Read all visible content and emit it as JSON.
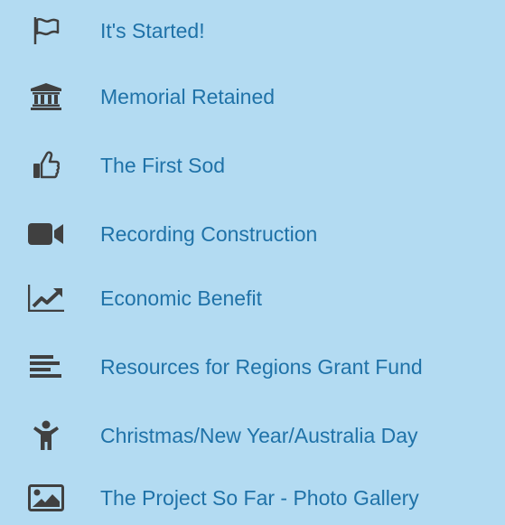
{
  "menu": {
    "items": [
      {
        "label": "It's Started!",
        "icon": "flag-icon"
      },
      {
        "label": "Memorial Retained",
        "icon": "institution-icon"
      },
      {
        "label": "The First Sod",
        "icon": "thumbs-up-icon"
      },
      {
        "label": "Recording Construction",
        "icon": "video-camera-icon"
      },
      {
        "label": "Economic Benefit",
        "icon": "line-chart-icon"
      },
      {
        "label": "Resources for Regions Grant Fund",
        "icon": "align-left-icon"
      },
      {
        "label": "Christmas/New Year/Australia Day",
        "icon": "child-icon"
      },
      {
        "label": "The Project So Far - Photo Gallery",
        "icon": "picture-icon"
      }
    ]
  },
  "colors": {
    "background": "#b3dbf2",
    "text": "#1f72a8",
    "icon": "#404040"
  }
}
